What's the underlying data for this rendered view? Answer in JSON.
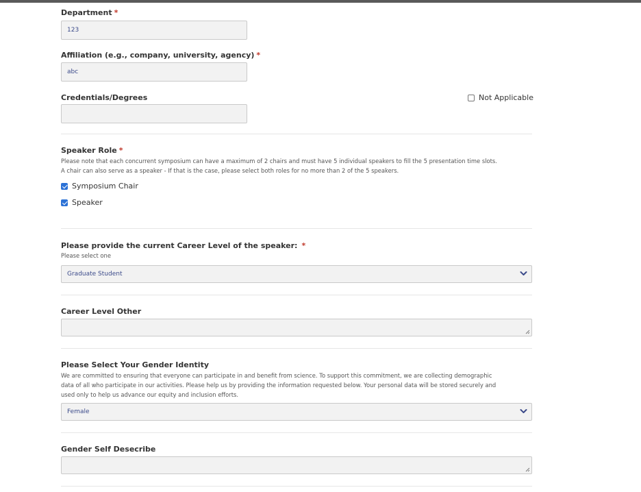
{
  "form": {
    "required_marker": "*",
    "department": {
      "label": "Department",
      "value": "123"
    },
    "affiliation": {
      "label": "Affiliation (e.g., company, university, agency)",
      "value": "abc"
    },
    "credentials": {
      "label": "Credentials/Degrees",
      "value": "",
      "not_applicable_label": "Not Applicable",
      "not_applicable_checked": false
    },
    "speaker_role": {
      "label": "Speaker Role",
      "help_line1": "Please note that each concurrent symposium can have a maximum of 2 chairs and must have 5 individual speakers to fill the 5 presentation time slots.",
      "help_line2": "A chair can also serve as a speaker - If that is the case, please select both roles for no more than 2 of the 5 speakers.",
      "options": [
        {
          "label": "Symposium Chair",
          "checked": true
        },
        {
          "label": "Speaker",
          "checked": true
        }
      ]
    },
    "career_level": {
      "label": "Please provide the current Career Level of the speaker:",
      "help": "Please select one",
      "selected": "Graduate Student"
    },
    "career_level_other": {
      "label": "Career Level Other",
      "value": ""
    },
    "gender_identity": {
      "label": "Please Select Your Gender Identity",
      "help_line1": "We are committed to ensuring that everyone can participate in and benefit from science. To support this commitment, we are collecting demographic",
      "help_line2": "data of all who participate in our activities. Please help us by providing the information requested below. Your personal data will be stored securely and",
      "help_line3": "used only to help us advance our equity and inclusion efforts.",
      "selected": "Female"
    },
    "gender_self_describe": {
      "label": "Gender Self Desecribe",
      "value": ""
    }
  },
  "colors": {
    "accent": "#2c72d6",
    "required": "#c0392b",
    "field_bg": "#f2f2f2",
    "field_text": "#3b4a8a"
  },
  "icons": {
    "chevron": "chevron-down-icon",
    "resize": "resize-grip-icon",
    "check": "checkmark-icon"
  }
}
